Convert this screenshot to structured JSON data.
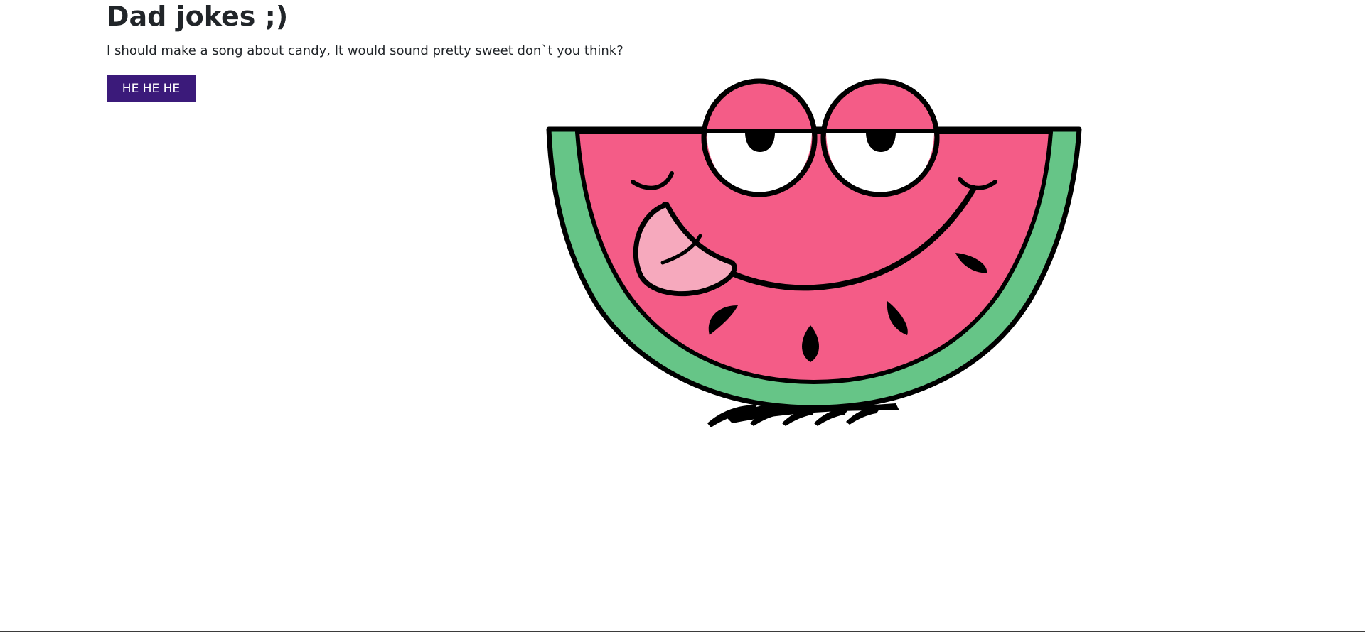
{
  "page": {
    "title": "Dad jokes ;)",
    "joke": "I should make a song about candy, It would sound pretty sweet don`t you think?",
    "button_label": "HE HE HE"
  },
  "colors": {
    "button_bg": "#3b1a7a",
    "melon_flesh": "#f45c87",
    "melon_rind": "#66c587",
    "tongue": "#f6a9bd"
  },
  "image": {
    "icon": "watermelon-character-illustration"
  }
}
